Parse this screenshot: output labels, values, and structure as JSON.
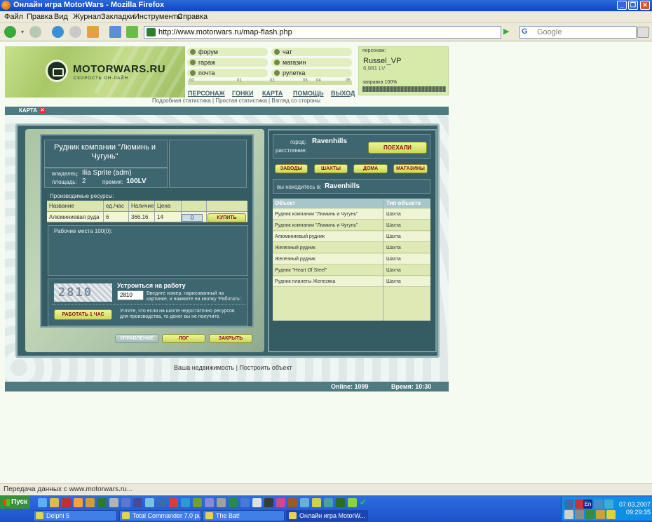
{
  "window": {
    "title": "Онлайн игра MotorWars - Mozilla Firefox"
  },
  "menu": [
    "Файл",
    "Правка",
    "Вид",
    "Журнал",
    "Закладки",
    "Инструменты",
    "Справка"
  ],
  "navbar": {
    "url": "http://www.motorwars.ru/map-flash.php",
    "search_placeholder": "Google"
  },
  "site": {
    "logo_text": "MOTORWARS.RU",
    "logo_sub": "СКОРОСТЬ ОН-ЛАЙН",
    "quick_links": [
      "форум",
      "чат",
      "гараж",
      "магазин",
      "почта",
      "рулетка"
    ],
    "progress_marks": [
      "00",
      "01",
      "02",
      "03",
      "04",
      "05"
    ],
    "nav": [
      "ПЕРСОНАЖ",
      "ГОНКИ",
      "КАРТА",
      "ПОМОЩЬ",
      "ВЫХОД"
    ],
    "stat_links": "Подробная статистика | Простая статистика | Взгляд со стороны"
  },
  "player": {
    "label": "персонаж:",
    "name": "Russel_VP",
    "money": "6,981 LV",
    "fuel": "заправка 100%",
    "fuel_percent": 100
  },
  "map": {
    "tab_label": "КАРТА",
    "mine": {
      "title": "Рудник компании \"Люминь и Чугунь\"",
      "owner_label": "владелец:",
      "owner": "Ilia Sprite (adm)",
      "area_label": "площадь:",
      "area": "2",
      "bonus_label": "премия:",
      "bonus": "100LV",
      "resources_label": "Производимые ресурсы:",
      "table_headers": [
        "Название",
        "ед./час",
        "Наличие",
        "Цена"
      ],
      "row": {
        "name": "Алюминиевая руда",
        "rate": "6",
        "stock": "366.16",
        "price": "14",
        "qty": "0"
      },
      "buy_label": "КУПИТЬ",
      "jobs_label": "Рабочие места 100(0):",
      "work_title": "Устроиться на работу",
      "captcha_digits": "2810",
      "captcha_input": "2810",
      "work_hint": "Введите номер, нарисованный на картинке, и нажмите на кнопку 'Работать'.",
      "work_warning": "Учтите, что если на шахте недостаточно ресурсов для производства, то денег вы не получите.",
      "work_button": "РАБОТАТЬ 1 ЧАС",
      "manage_button": "УПРАВЛЕНИЕ",
      "log_button": "ЛОГ",
      "close_button": "ЗАКРЫТЬ"
    },
    "city": {
      "city_label": "город:",
      "city": "Ravenhills",
      "distance_label": "расстояние:",
      "go_button": "ПОЕХАЛИ",
      "filters": [
        "ЗАВОДЫ",
        "ШАХТЫ",
        "ДОМА",
        "МАГАЗИНЫ"
      ],
      "location_label": "вы находитесь в:",
      "location": "Ravenhills",
      "headers": [
        "Объект",
        "Тип объекта"
      ],
      "objects": [
        {
          "name": "Рудник компании \"Люминь и Чугунь\"",
          "type": "Шахта"
        },
        {
          "name": "Рудник компании \"Люминь и Чугунь\"",
          "type": "Шахта"
        },
        {
          "name": "Алюминиевый рудник",
          "type": "Шахта"
        },
        {
          "name": "Железный рудник",
          "type": "Шахта"
        },
        {
          "name": "Железный рудник",
          "type": "Шахта"
        },
        {
          "name": "Рудник \"Heart Of Steel\"",
          "type": "Шахта"
        },
        {
          "name": "Рудник планеты Железяка",
          "type": "Шахта"
        }
      ]
    },
    "bottom_links": "Ваша недвижимость | Построить объект",
    "online": "Online: 1099",
    "time": "Время: 10:30"
  },
  "status": {
    "text": "Передача данных с www.motorwars.ru..."
  },
  "taskbar": {
    "start": "Пуск",
    "tasks": [
      "Delphi 5",
      "Total Commander 7.0 publi...",
      "The Bat!",
      "Онлайн игра MotorW..."
    ],
    "date": "07.03.2007",
    "time": "09:29:35",
    "lang": "En"
  }
}
